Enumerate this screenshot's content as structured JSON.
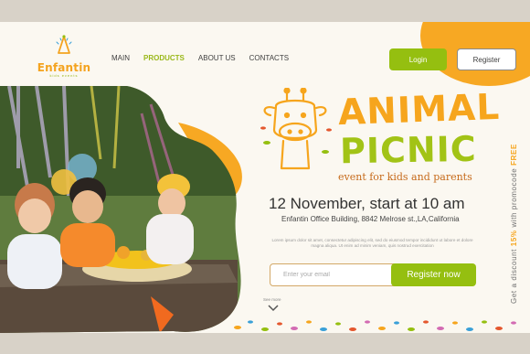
{
  "brand": {
    "name": "Enfantin",
    "sub": "kids events"
  },
  "nav": {
    "main": "MAIN",
    "products": "PRODUCTS",
    "about": "ABOUT US",
    "contacts": "CONTACTS"
  },
  "auth": {
    "login": "Login",
    "register": "Register"
  },
  "hero": {
    "title_line1": "ANIMAL",
    "title_line2": "PICNIC",
    "tagline": "event for kids and parents",
    "date": "12 November, start at 10 am",
    "address": "Enfantin Office Building, 8842 Melrose st.,LA,California",
    "lorem": "Lorem ipsum dolor sit amet, consectetur adipiscing elit, sed do eiusmod tempor incididunt ut labore et dolore magna aliqua. Ut enim ad minim veniam, quis nostrud exercitation"
  },
  "signup": {
    "placeholder": "Enter your email",
    "button": "Register now"
  },
  "see_more": "See more",
  "promo": {
    "prefix": "Get a discount ",
    "percent": "15%",
    "middle": " with promocode ",
    "code": "FREE"
  },
  "colors": {
    "orange": "#f6a51d",
    "green": "#95bf10",
    "bg": "#fbf8f1"
  }
}
